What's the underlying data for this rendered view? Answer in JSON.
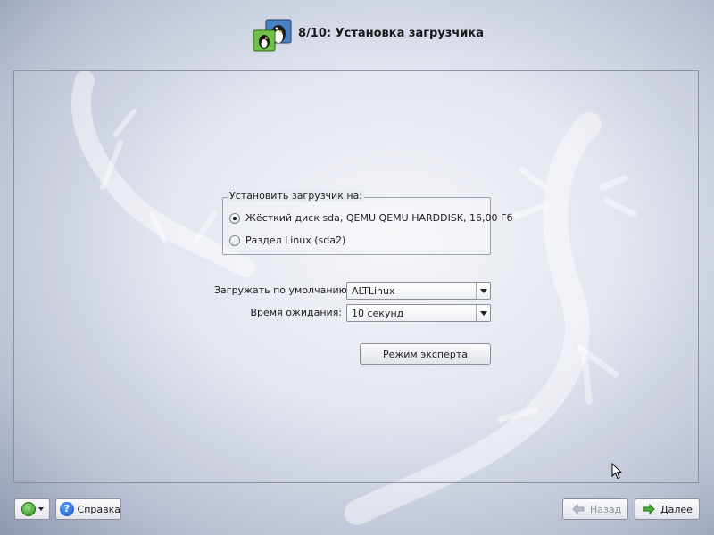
{
  "header": {
    "title": "8/10: Установка загрузчика",
    "icon": "installer-penguin-icon"
  },
  "bootloader_target": {
    "legend": "Установить загрузчик на:",
    "options": [
      {
        "label": "Жёсткий диск sda, QEMU QEMU HARDDISK, 16,00 Гб",
        "selected": true
      },
      {
        "label": "Раздел Linux (sda2)",
        "selected": false
      }
    ]
  },
  "default_boot": {
    "label": "Загружать по умолчанию:",
    "value": "ALTLinux"
  },
  "timeout": {
    "label": "Время ожидания:",
    "value": "10 секунд"
  },
  "expert_button": {
    "label": "Режим эксперта"
  },
  "footer": {
    "menu_icon": "plus-circle-icon",
    "help_label": "Справка",
    "back_label": "Назад",
    "next_label": "Далее"
  },
  "colors": {
    "background_center": "#f5f6fa",
    "background_edge": "#8d97b1",
    "disabled_text": "#8e929a"
  }
}
